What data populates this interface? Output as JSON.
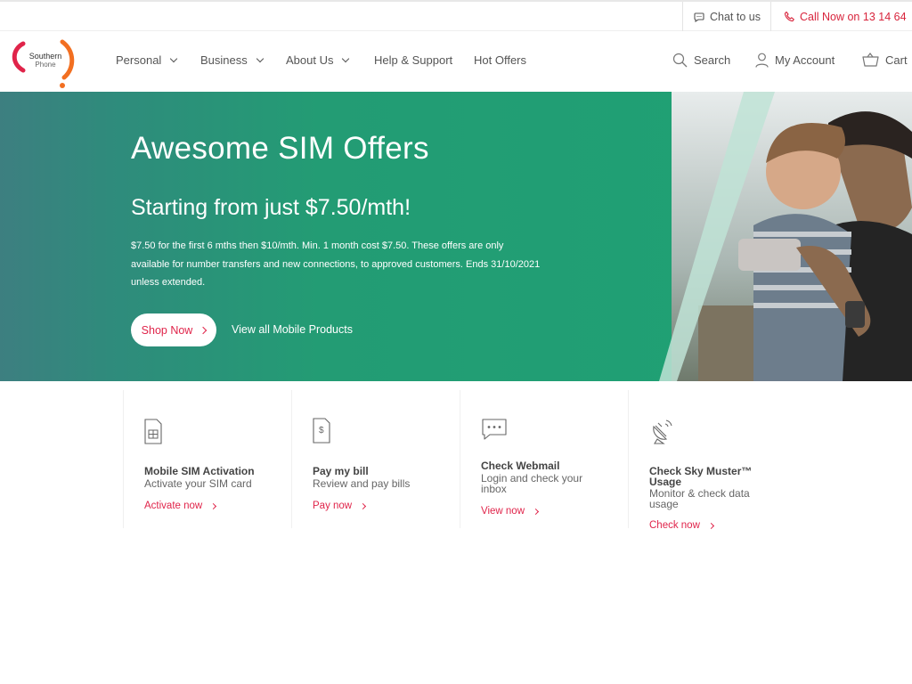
{
  "utility": {
    "chat_label": "Chat to us",
    "call_label": "Call Now on 13 14 64"
  },
  "logo": {
    "line1": "Southern",
    "line2": "Phone"
  },
  "nav": {
    "items": [
      {
        "label": "Personal",
        "icon": "chevron-down-icon"
      },
      {
        "label": "Business",
        "icon": "chevron-down-icon"
      },
      {
        "label": "About Us",
        "icon": "chevron-down-icon"
      },
      {
        "label": "Help & Support"
      },
      {
        "label": "Hot Offers"
      }
    ],
    "search_label": "Search",
    "account_label": "My Account",
    "cart_label": "Cart"
  },
  "hero": {
    "title": "Awesome SIM Offers",
    "subtitle": "Starting from just $7.50/mth!",
    "terms": "$7.50 for the first 6 mths then $10/mth. Min. 1 month cost $7.50. These offers are only available for number transfers and new connections, to approved customers. Ends 31/10/2021 unless extended.",
    "cta_label": "Shop Now",
    "secondary_label": "View all Mobile Products"
  },
  "quick_links": [
    {
      "icon": "sim-card-icon",
      "title": "Mobile SIM Activation",
      "description": "Activate your SIM card",
      "link": "Activate now"
    },
    {
      "icon": "bill-icon",
      "title": "Pay my bill",
      "description": "Review and pay bills",
      "link": "Pay now"
    },
    {
      "icon": "chat-bubble-icon",
      "title": "Check Webmail",
      "description": "Login and check your inbox",
      "link": "View now"
    },
    {
      "icon": "satellite-dish-icon",
      "title": "Check Sky Muster™ Usage",
      "description": "Monitor & check data usage",
      "link": "Check now"
    }
  ],
  "colors": {
    "brand_red": "#e0244a",
    "hero_green": "#1ea273",
    "hero_teal": "#3d7f80",
    "text_gray": "#555555"
  }
}
